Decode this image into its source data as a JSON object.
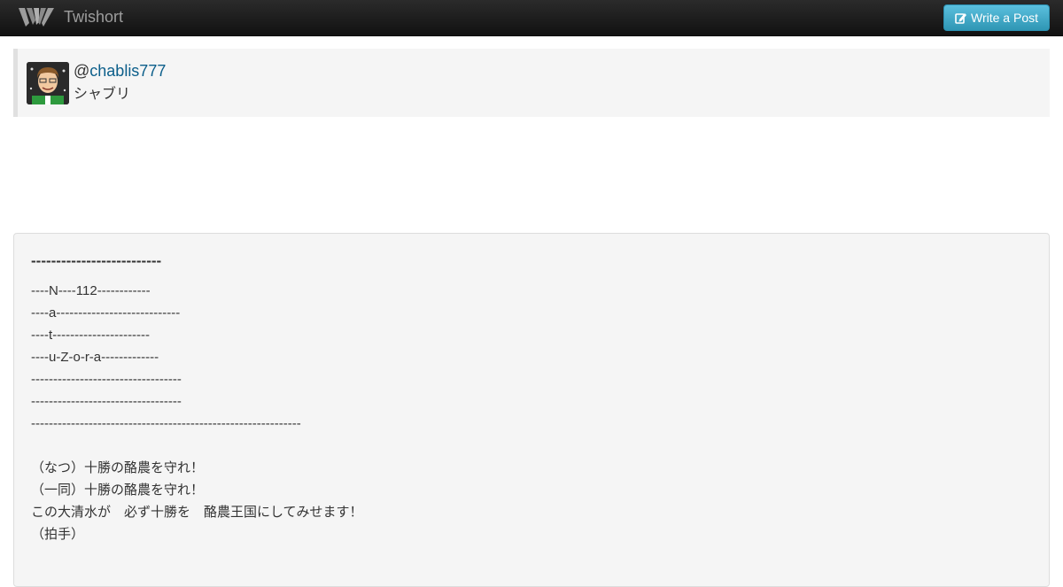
{
  "navbar": {
    "logo_icon": "twishort-bird-logo-icon",
    "brand": "Twishort",
    "write_button": {
      "icon": "edit-icon",
      "label": "Write a Post"
    }
  },
  "profile": {
    "avatar": "user-avatar",
    "at_sign": "@",
    "handle": "chablis777",
    "display_name": "シャブリ"
  },
  "post": {
    "heading": "--------------------------",
    "lines": [
      "----N----112------------",
      "----a----------------------------",
      "----t----------------------",
      "----u-Z-o-r-a-------------",
      "----------------------------------",
      "----------------------------------",
      "-------------------------------------------------------------",
      "",
      "（なつ）十勝の酪農を守れ！",
      "（一同）十勝の酪農を守れ！",
      "この大清水が　必ず十勝を　酪農王国にしてみせます！",
      "（拍手）"
    ]
  },
  "colors": {
    "navbar_bg": "#1b1b1b",
    "button_bg": "#49afcd",
    "link": "#0b5e8a",
    "panel_bg": "#f5f5f5"
  }
}
